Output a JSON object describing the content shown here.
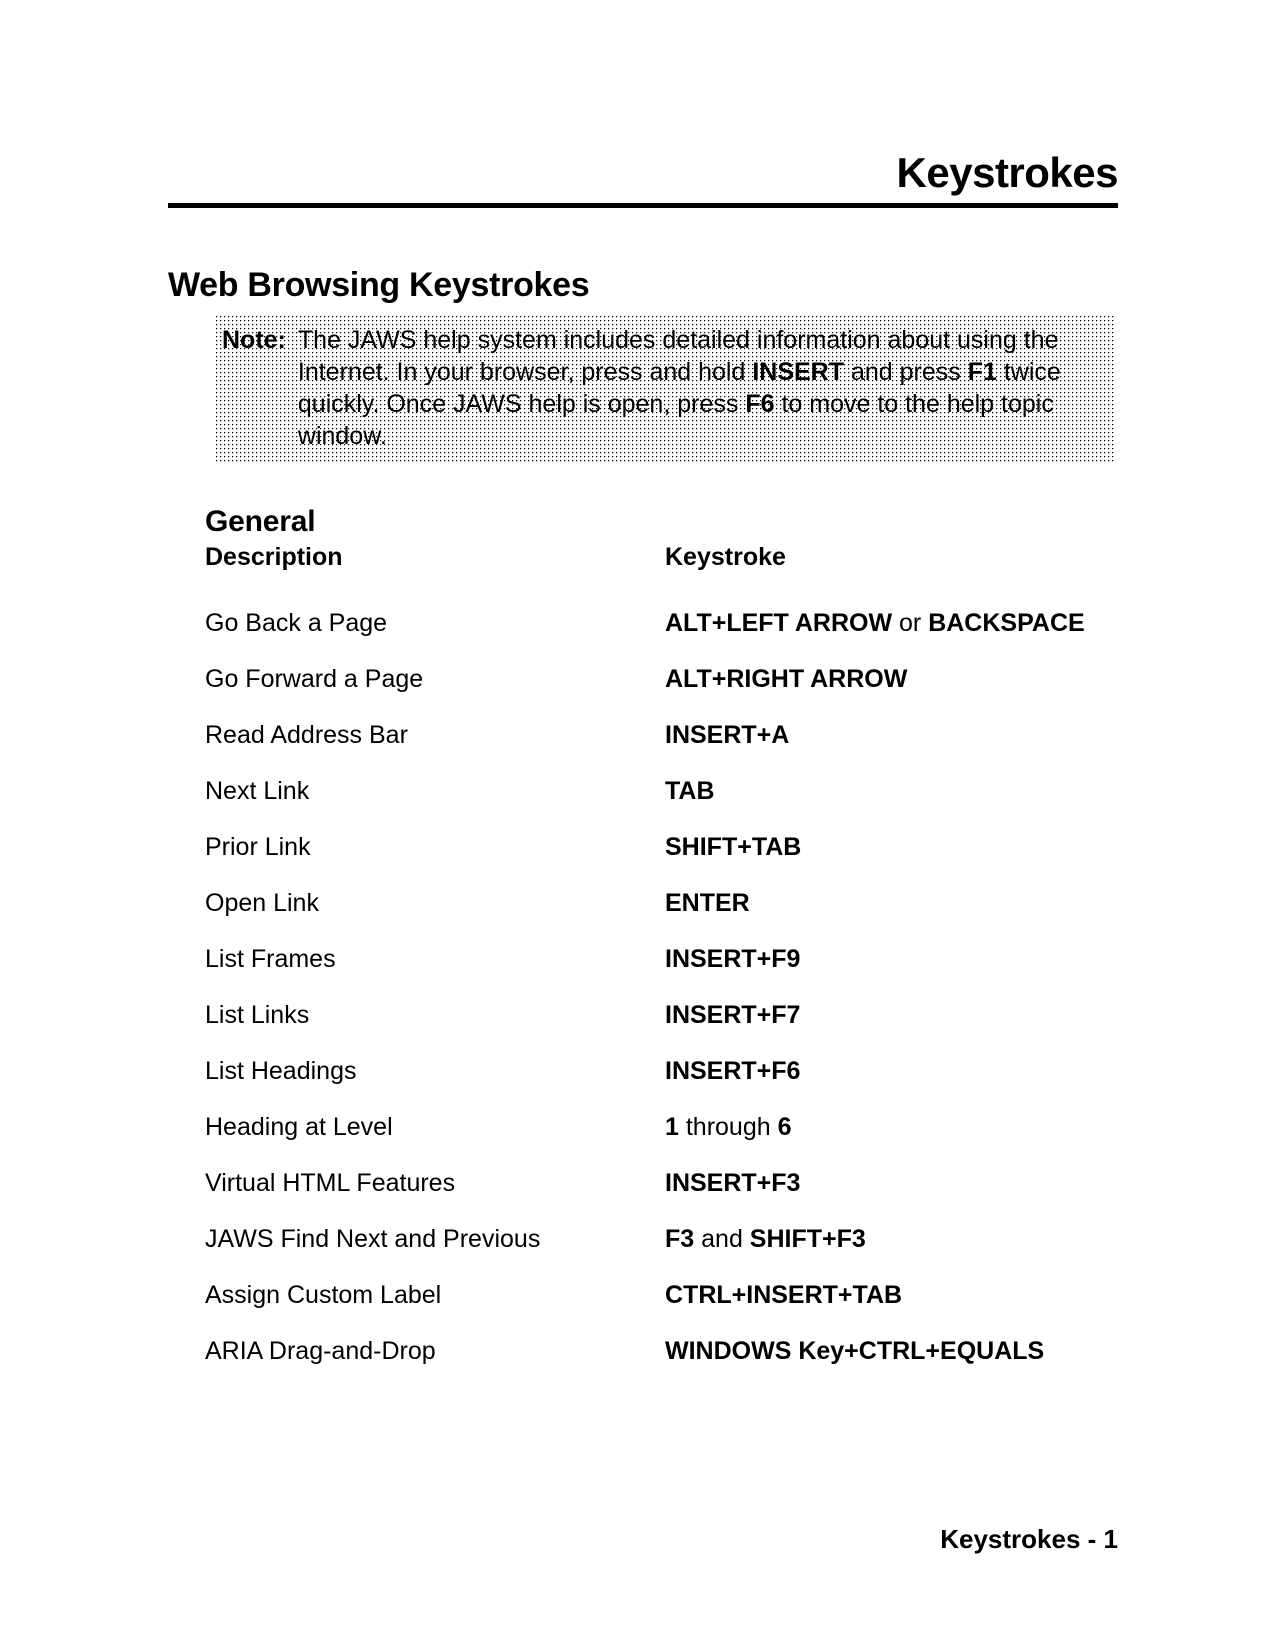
{
  "header": {
    "running_title": "Keystrokes"
  },
  "section": {
    "title": "Web Browsing Keystrokes"
  },
  "note": {
    "label": "Note:",
    "segments": [
      {
        "text": "The JAWS help system includes detailed information about using the Internet. In your browser, press and hold ",
        "bold": false
      },
      {
        "text": "INSERT",
        "bold": true
      },
      {
        "text": " and press ",
        "bold": false
      },
      {
        "text": "F1",
        "bold": true
      },
      {
        "text": " twice quickly. Once JAWS help is open, press ",
        "bold": false
      },
      {
        "text": "F6",
        "bold": true
      },
      {
        "text": " to move to the help topic window.",
        "bold": false
      }
    ],
    "plain_text": "The JAWS help system includes detailed information about using the Internet. In your browser, press and hold INSERT and press F1 twice quickly. Once JAWS help is open, press F6 to move to the help topic window."
  },
  "subsection": {
    "title": "General"
  },
  "table": {
    "columns": [
      "Description",
      "Keystroke"
    ],
    "rows": [
      {
        "description": "Go Back a Page",
        "keystroke": "ALT+LEFT ARROW or BACKSPACE",
        "segments": [
          {
            "text": "ALT+LEFT ARROW",
            "bold": true
          },
          {
            "text": " or ",
            "bold": false
          },
          {
            "text": "BACKSPACE",
            "bold": true
          }
        ]
      },
      {
        "description": "Go Forward a Page",
        "keystroke": "ALT+RIGHT ARROW",
        "segments": [
          {
            "text": "ALT+RIGHT ARROW",
            "bold": true
          }
        ]
      },
      {
        "description": "Read Address Bar",
        "keystroke": "INSERT+A",
        "segments": [
          {
            "text": "INSERT+A",
            "bold": true
          }
        ]
      },
      {
        "description": "Next Link",
        "keystroke": "TAB",
        "segments": [
          {
            "text": "TAB",
            "bold": true
          }
        ]
      },
      {
        "description": "Prior Link",
        "keystroke": "SHIFT+TAB",
        "segments": [
          {
            "text": "SHIFT+TAB",
            "bold": true
          }
        ]
      },
      {
        "description": "Open Link",
        "keystroke": "ENTER",
        "segments": [
          {
            "text": "ENTER",
            "bold": true
          }
        ]
      },
      {
        "description": "List Frames",
        "keystroke": "INSERT+F9",
        "segments": [
          {
            "text": "INSERT+F9",
            "bold": true
          }
        ]
      },
      {
        "description": "List Links",
        "keystroke": "INSERT+F7",
        "segments": [
          {
            "text": "INSERT+F7",
            "bold": true
          }
        ]
      },
      {
        "description": "List Headings",
        "keystroke": "INSERT+F6",
        "segments": [
          {
            "text": "INSERT+F6",
            "bold": true
          }
        ]
      },
      {
        "description": "Heading at Level",
        "keystroke": "1 through 6",
        "segments": [
          {
            "text": "1",
            "bold": true
          },
          {
            "text": " through ",
            "bold": false
          },
          {
            "text": "6",
            "bold": true
          }
        ]
      },
      {
        "description": "Virtual HTML Features",
        "keystroke": "INSERT+F3",
        "segments": [
          {
            "text": "INSERT+F3",
            "bold": true
          }
        ]
      },
      {
        "description": "JAWS Find Next and Previous",
        "keystroke": "F3 and SHIFT+F3",
        "segments": [
          {
            "text": "F3",
            "bold": true
          },
          {
            "text": " and ",
            "bold": false
          },
          {
            "text": "SHIFT+F3",
            "bold": true
          }
        ]
      },
      {
        "description": "Assign Custom Label",
        "keystroke": "CTRL+INSERT+TAB",
        "segments": [
          {
            "text": "CTRL+INSERT+TAB",
            "bold": true
          }
        ]
      },
      {
        "description": "ARIA Drag-and-Drop",
        "keystroke": "WINDOWS Key+CTRL+EQUALS",
        "segments": [
          {
            "text": "WINDOWS Key+CTRL+EQUALS",
            "bold": true
          }
        ]
      }
    ]
  },
  "footer": {
    "text": "Keystrokes - 1"
  }
}
